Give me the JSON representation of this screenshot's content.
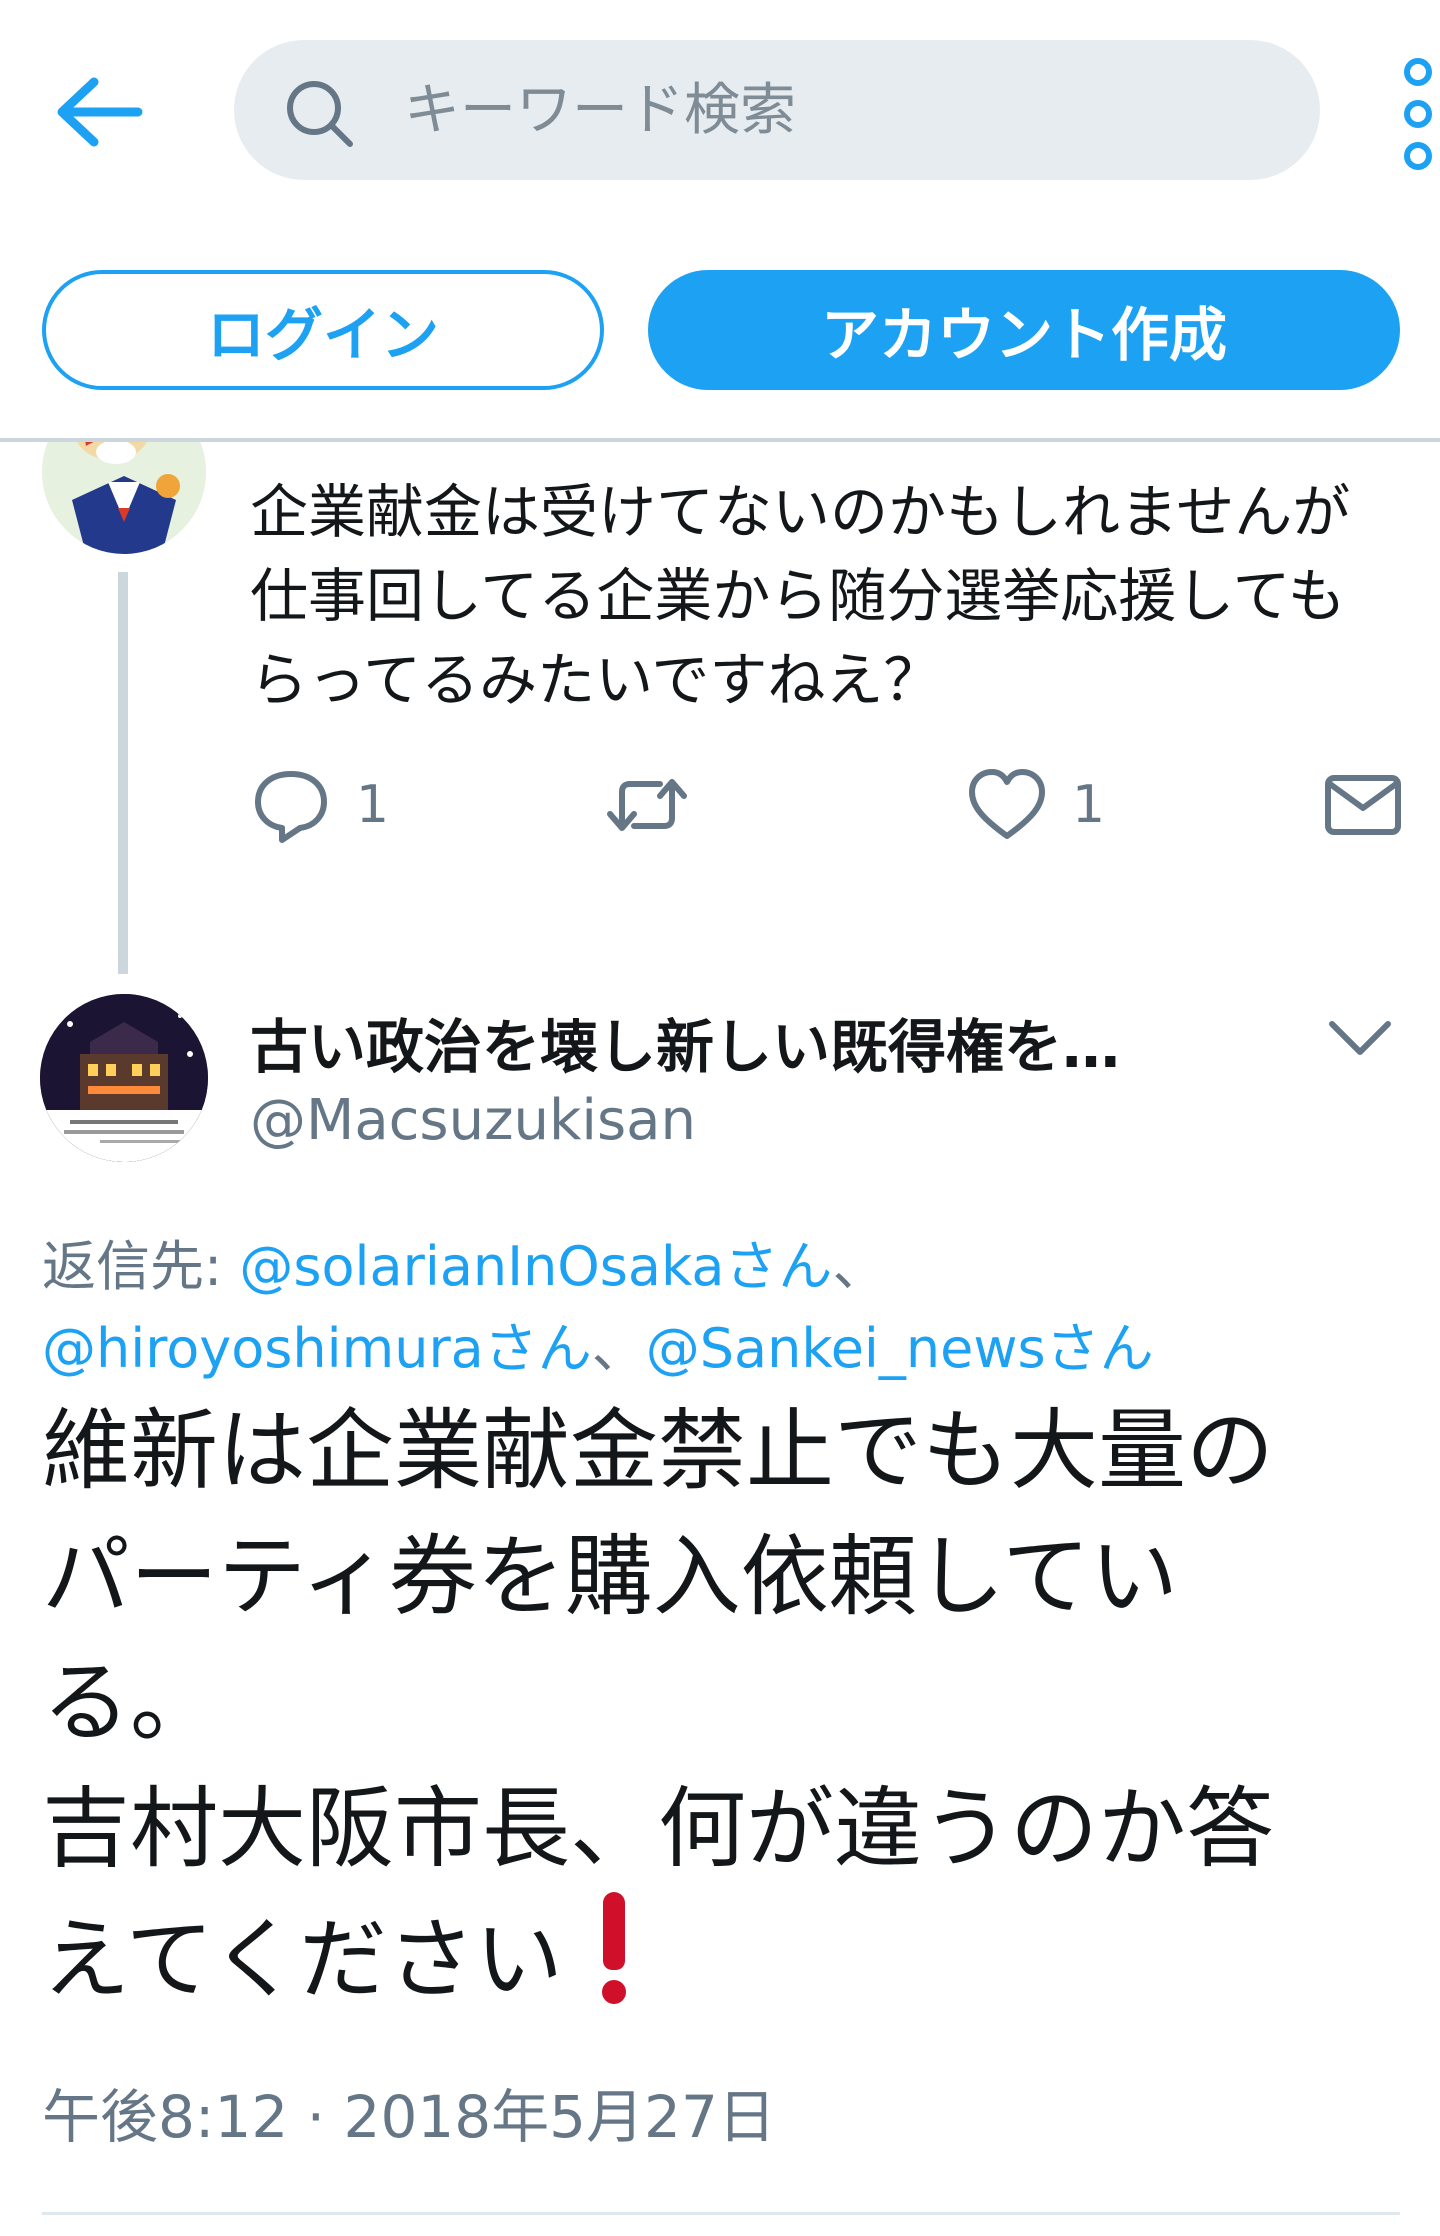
{
  "header": {
    "search_placeholder": "キーワード検索",
    "login_label": "ログイン",
    "signup_label": "アカウント作成"
  },
  "prev_tweet": {
    "text": "企業献金は受けてないのかもしれませんが仕事回してる企業から随分選挙応援してもらってるみたいですねえ？",
    "actions": {
      "reply_count": "1",
      "like_count": "1"
    }
  },
  "tweet": {
    "author_name": "古い政治を壊し新しい既得権を…",
    "author_handle": "@Macsuzukisan",
    "reply_prefix": "返信先: ",
    "mentions": [
      "@solarianInOsakaさん",
      "@hiroyoshimuraさん",
      "@Sankei_newsさん"
    ],
    "separator": "、",
    "body_lines": [
      "維新は企業献金禁止でも大量の",
      "パーティ券を購入依頼してい",
      "る。",
      "吉村大阪市長、何が違うのか答",
      "えてください"
    ],
    "timestamp": "午後8:12 · 2018年5月27日"
  },
  "colors": {
    "accent": "#1da1f2",
    "muted": "#657786",
    "search_bg": "#e6ecf0",
    "exclamation": "#d0102a"
  },
  "icons": [
    "back-arrow-icon",
    "search-icon",
    "more-vertical-icon",
    "reply-icon",
    "retweet-icon",
    "like-icon",
    "direct-message-icon",
    "chevron-down-icon",
    "exclamation-icon"
  ]
}
